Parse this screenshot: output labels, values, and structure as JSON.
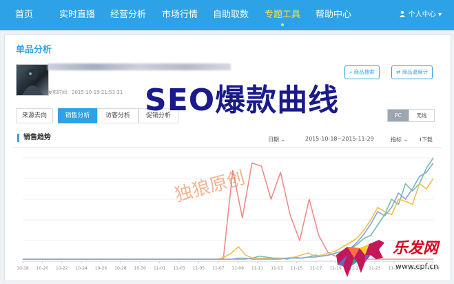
{
  "nav": {
    "items": [
      {
        "label": "首页"
      },
      {
        "label": "实时直播"
      },
      {
        "label": "经营分析"
      },
      {
        "label": "市场行情"
      },
      {
        "label": "自助取数"
      },
      {
        "label": "专题工具"
      },
      {
        "label": "帮助中心"
      }
    ],
    "active_index": 5,
    "user_label": "个人中心"
  },
  "page": {
    "title": "单品分析",
    "publish_time": "发布时间：2015-10-19 21:53:31",
    "btn_product_search": "商品搜索",
    "btn_product_thermometer": "商品温度计"
  },
  "tabs": [
    {
      "label": "来源去向"
    },
    {
      "label": "销售分析"
    },
    {
      "label": "访客分析"
    },
    {
      "label": "促销分析"
    }
  ],
  "active_tab": 1,
  "terminal": {
    "pc": "PC",
    "wireless": "无线"
  },
  "section": {
    "title": "销售趋势",
    "date_label": "日期",
    "date_range": "2015-10-18~2015-11-29",
    "metric_label": "指标",
    "download": "下载"
  },
  "watermark": {
    "overlay": "SEO爆款曲线",
    "author": "独狼原创"
  },
  "logo": {
    "name": "乐发网",
    "url": "www.cpf.cn"
  },
  "colors": {
    "accent": "#2ea2e6",
    "active_nav": "#ffe24a",
    "seo_text": "#1a1a8a",
    "logo": "#d8001c"
  },
  "chart_data": {
    "type": "line",
    "x_ticks": [
      "10-18",
      "10-20",
      "10-22",
      "10-24",
      "10-26",
      "10-28",
      "10-30",
      "11-01",
      "11-03",
      "11-05",
      "11-07",
      "11-09",
      "11-11",
      "11-13",
      "11-15",
      "11-17",
      "11-19",
      "11-21",
      "11-23",
      "11-25",
      "11-27",
      "11-29"
    ],
    "ylim": [
      0,
      100
    ],
    "grid": true,
    "series": [
      {
        "color": "#f08a8a",
        "values": [
          2,
          2,
          2,
          2,
          2,
          2,
          2,
          2,
          2,
          2,
          2,
          2,
          2,
          2,
          2,
          2,
          2,
          2,
          2,
          2,
          2,
          2,
          88,
          42,
          95,
          92,
          60,
          86,
          45,
          20,
          60,
          25,
          8,
          4,
          2,
          2,
          2,
          2,
          2,
          2,
          2,
          2,
          2,
          2
        ]
      },
      {
        "color": "#6fc1a8",
        "values": [
          2,
          2,
          2,
          2,
          2,
          2,
          2,
          2,
          2,
          2,
          2,
          2,
          2,
          2,
          2,
          2,
          2,
          2,
          2,
          2,
          2,
          2,
          2,
          2,
          2,
          2,
          2,
          2,
          2,
          2,
          2,
          2,
          2,
          3,
          5,
          4,
          3,
          3,
          2,
          4,
          3,
          4,
          6,
          5,
          6,
          8,
          10,
          12,
          16,
          22,
          25,
          35,
          45,
          60,
          55,
          75,
          68,
          75,
          90,
          100
        ]
      },
      {
        "color": "#f3bf4a",
        "values": [
          2,
          2,
          2,
          2,
          2,
          2,
          2,
          2,
          2,
          2,
          2,
          2,
          2,
          2,
          2,
          2,
          2,
          2,
          2,
          2,
          2,
          2,
          2,
          2,
          2,
          2,
          2,
          2,
          2,
          4,
          8,
          14,
          6,
          3,
          3,
          3,
          2,
          3,
          3,
          4,
          6,
          8,
          5,
          6,
          8,
          10,
          14,
          18,
          22,
          30,
          40,
          52,
          48,
          45,
          60,
          58,
          55,
          75,
          70,
          80
        ]
      },
      {
        "color": "#8aa3d6",
        "values": [
          2,
          2,
          2,
          2,
          2,
          2,
          2,
          2,
          2,
          2,
          2,
          2,
          2,
          2,
          2,
          2,
          2,
          2,
          2,
          2,
          2,
          2,
          2,
          2,
          2,
          2,
          2,
          2,
          2,
          2,
          2,
          3,
          3,
          2,
          2,
          2,
          2,
          2,
          3,
          3,
          3,
          4,
          4,
          5,
          6,
          8,
          10,
          12,
          18,
          26,
          36,
          48,
          44,
          52,
          66,
          60,
          70,
          82,
          86,
          95
        ]
      }
    ]
  }
}
